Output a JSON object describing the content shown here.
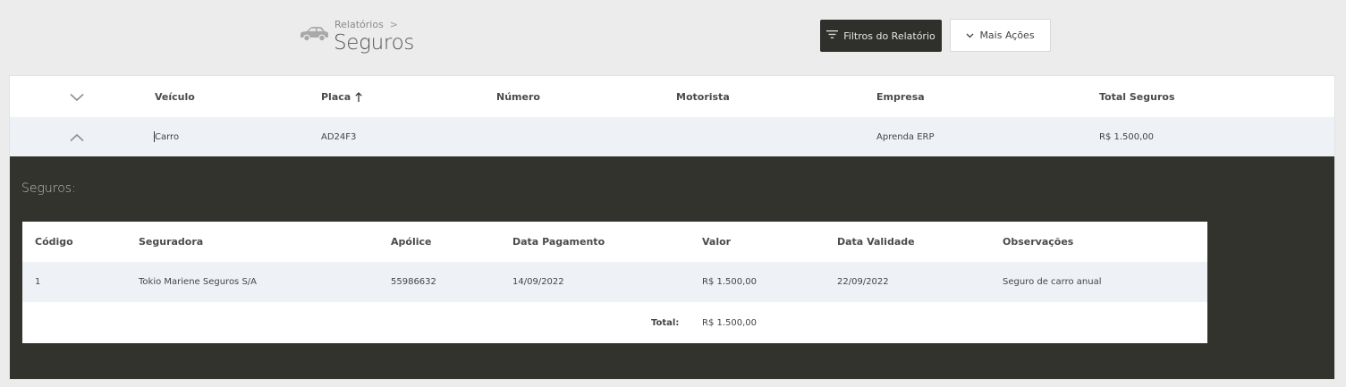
{
  "header": {
    "breadcrumb_parent": "Relatórios",
    "breadcrumb_separator": ">",
    "title": "Seguros",
    "icon": "car-icon",
    "buttons": {
      "filters_label": "Filtros do Relatório",
      "filters_icon": "filter-icon",
      "more_actions_label": "Mais Ações",
      "more_actions_icon": "chevron-down-icon"
    }
  },
  "main_table": {
    "columns": [
      "Veículo",
      "Placa",
      "Número",
      "Motorista",
      "Empresa",
      "Total Seguros"
    ],
    "sort_column": "Placa",
    "sort_direction": "ascending",
    "sort_icon": "arrow-up-icon",
    "rows": [
      {
        "veiculo": "Carro",
        "placa": "AD24F3",
        "numero": "",
        "motorista": "",
        "empresa": "Aprenda ERP",
        "total_seguros": "R$ 1.500,00",
        "expanded": true
      }
    ]
  },
  "detail": {
    "title": "Seguros:",
    "columns": [
      "Código",
      "Seguradora",
      "Apólice",
      "Data Pagamento",
      "Valor",
      "Data Validade",
      "Observações"
    ],
    "rows": [
      {
        "codigo": "1",
        "seguradora": "Tokio Mariene Seguros S/A",
        "apolice": "55986632",
        "data_pagamento": "14/09/2022",
        "valor": "R$ 1.500,00",
        "data_validade": "22/09/2022",
        "observacoes": "Seguro de carro anual"
      }
    ],
    "total_label": "Total:",
    "total_value": "R$ 1.500,00"
  },
  "colors": {
    "dark_panel": "#33332e",
    "filters_button": "#2f2f2c",
    "row_highlight": "#eef2f6",
    "page_background": "#ececec"
  }
}
